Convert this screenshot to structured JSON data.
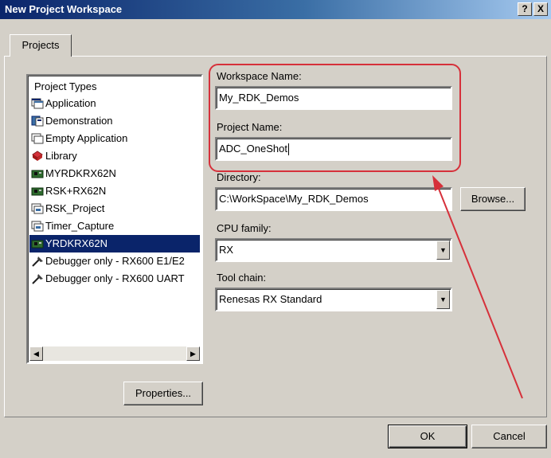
{
  "window": {
    "title": "New Project Workspace",
    "help_label": "?",
    "close_label": "X"
  },
  "tabs": [
    {
      "label": "Projects"
    }
  ],
  "project_types": {
    "header": "Project Types",
    "items": [
      {
        "label": "Application",
        "icon": "application-icon"
      },
      {
        "label": "Demonstration",
        "icon": "demonstration-icon"
      },
      {
        "label": "Empty Application",
        "icon": "empty-application-icon"
      },
      {
        "label": "Library",
        "icon": "library-icon"
      },
      {
        "label": "MYRDKRX62N",
        "icon": "board-icon"
      },
      {
        "label": "RSK+RX62N",
        "icon": "board-icon"
      },
      {
        "label": "RSK_Project",
        "icon": "project-icon"
      },
      {
        "label": "Timer_Capture",
        "icon": "project-icon"
      },
      {
        "label": "YRDKRX62N",
        "icon": "board-icon",
        "selected": true
      },
      {
        "label": "Debugger only - RX600 E1/E2",
        "icon": "debugger-icon"
      },
      {
        "label": "Debugger only - RX600 UART",
        "icon": "debugger-icon"
      }
    ],
    "scroll_left": "◀",
    "scroll_right": "▶"
  },
  "form": {
    "workspace_label": "Workspace Name:",
    "workspace_value": "My_RDK_Demos",
    "project_label": "Project Name:",
    "project_value": "ADC_OneShot",
    "directory_label": "Directory:",
    "directory_value": "C:\\WorkSpace\\My_RDK_Demos",
    "cpu_label": "CPU family:",
    "cpu_value": "RX",
    "toolchain_label": "Tool chain:",
    "toolchain_value": "Renesas RX Standard"
  },
  "buttons": {
    "browse": "Browse...",
    "properties": "Properties...",
    "ok": "OK",
    "cancel": "Cancel"
  },
  "annotation": {
    "color": "#d6303a"
  }
}
